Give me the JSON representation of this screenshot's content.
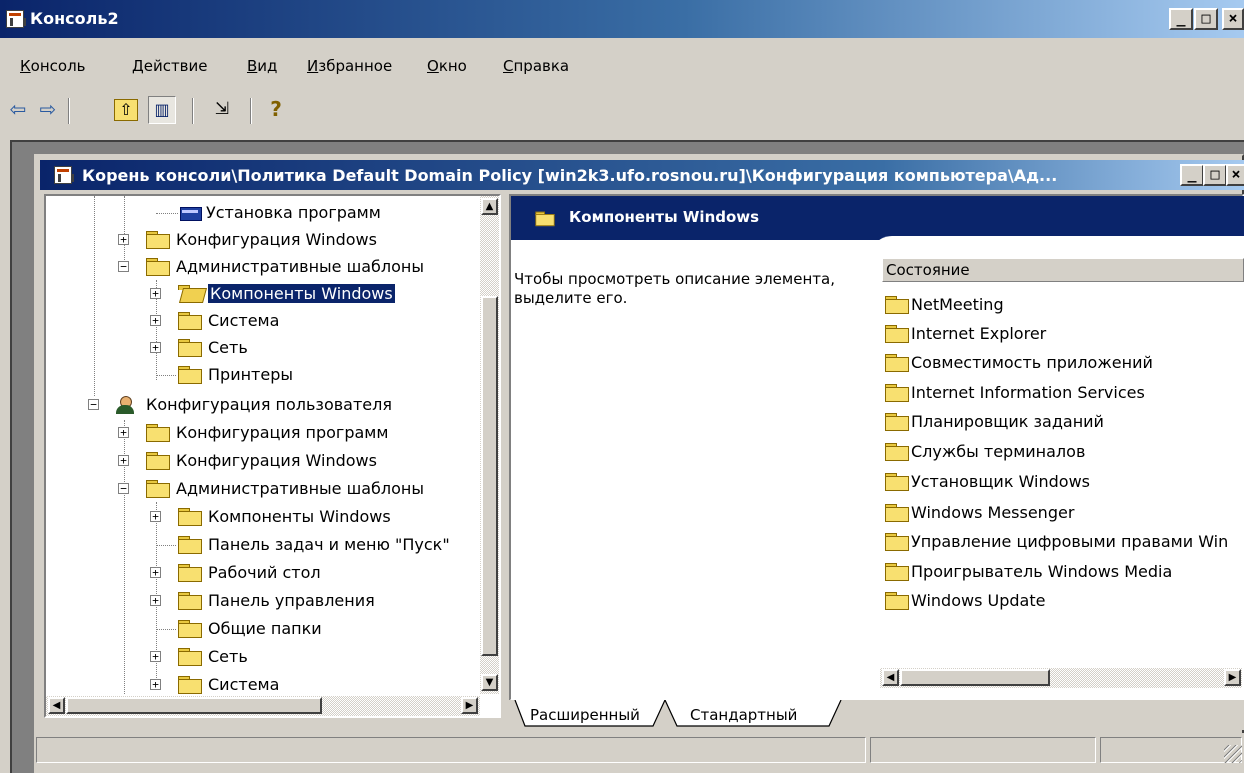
{
  "window": {
    "title": "Консоль2",
    "minimize_glyph": "_",
    "maximize_glyph": "□",
    "close_glyph": "×"
  },
  "menu": [
    {
      "label": "Консоль",
      "accel": "К",
      "rest": "онсоль"
    },
    {
      "label": "Действие",
      "accel": "Д",
      "rest": "ействие"
    },
    {
      "label": "Вид",
      "accel": "В",
      "rest": "ид"
    },
    {
      "label": "Избранное",
      "accel": "И",
      "rest": "збранное"
    },
    {
      "label": "Окно",
      "accel": "О",
      "rest": "кно"
    },
    {
      "label": "Справка",
      "accel": "С",
      "rest": "правка"
    }
  ],
  "toolbar": {
    "back_glyph": "⇦",
    "forward_glyph": "⇨",
    "up_glyph": "⇧",
    "tree_glyph": "▥",
    "export_glyph": "⇲",
    "help_glyph": "?"
  },
  "child_window": {
    "title": "Корень консоли\\Политика Default Domain Policy [win2k3.ufo.rosnou.ru]\\Конфигурация компьютера\\Ад..."
  },
  "tree": [
    {
      "label": "Установка программ",
      "icon": "package-icon",
      "expander": ""
    },
    {
      "label": "Конфигурация Windows",
      "icon": "folder-icon",
      "expander": "+"
    },
    {
      "label": "Административные шаблоны",
      "icon": "folder-icon",
      "expander": "−"
    },
    {
      "label": "Компоненты Windows",
      "icon": "folder-open-icon",
      "expander": "+",
      "selected": true
    },
    {
      "label": "Система",
      "icon": "folder-icon",
      "expander": "+"
    },
    {
      "label": "Сеть",
      "icon": "folder-icon",
      "expander": "+"
    },
    {
      "label": "Принтеры",
      "icon": "folder-icon",
      "expander": ""
    },
    {
      "label": "Конфигурация пользователя",
      "icon": "user-config-icon",
      "expander": "−"
    },
    {
      "label": "Конфигурация программ",
      "icon": "folder-icon",
      "expander": "+"
    },
    {
      "label": "Конфигурация Windows",
      "icon": "folder-icon",
      "expander": "+"
    },
    {
      "label": "Административные шаблоны",
      "icon": "folder-icon",
      "expander": "−"
    },
    {
      "label": "Компоненты Windows",
      "icon": "folder-icon",
      "expander": "+"
    },
    {
      "label": "Панель задач и меню \"Пуск\"",
      "icon": "folder-icon",
      "expander": ""
    },
    {
      "label": "Рабочий стол",
      "icon": "folder-icon",
      "expander": "+"
    },
    {
      "label": "Панель управления",
      "icon": "folder-icon",
      "expander": "+"
    },
    {
      "label": "Общие папки",
      "icon": "folder-icon",
      "expander": ""
    },
    {
      "label": "Сеть",
      "icon": "folder-icon",
      "expander": "+"
    },
    {
      "label": "Система",
      "icon": "folder-icon",
      "expander": "+"
    }
  ],
  "details": {
    "header": "Компоненты Windows",
    "description": "Чтобы просмотреть описание элемента, выделите его.",
    "column": "Состояние",
    "items": [
      "NetMeeting",
      "Internet Explorer",
      "Совместимость приложений",
      "Internet Information Services",
      "Планировщик заданий",
      "Службы терминалов",
      "Установщик Windows",
      "Windows Messenger",
      "Управление цифровыми правами Win",
      "Проигрыватель Windows Media",
      "Windows Update"
    ]
  },
  "tabs": [
    {
      "label": "Расширенный",
      "active": true
    },
    {
      "label": "Стандартный",
      "active": false
    }
  ],
  "scroll": {
    "up_glyph": "▲",
    "down_glyph": "▼",
    "left_glyph": "◀",
    "right_glyph": "▶"
  },
  "colors": {
    "title_active": "#0a246a",
    "face": "#d4d0c8",
    "folder": "#f8e070"
  }
}
